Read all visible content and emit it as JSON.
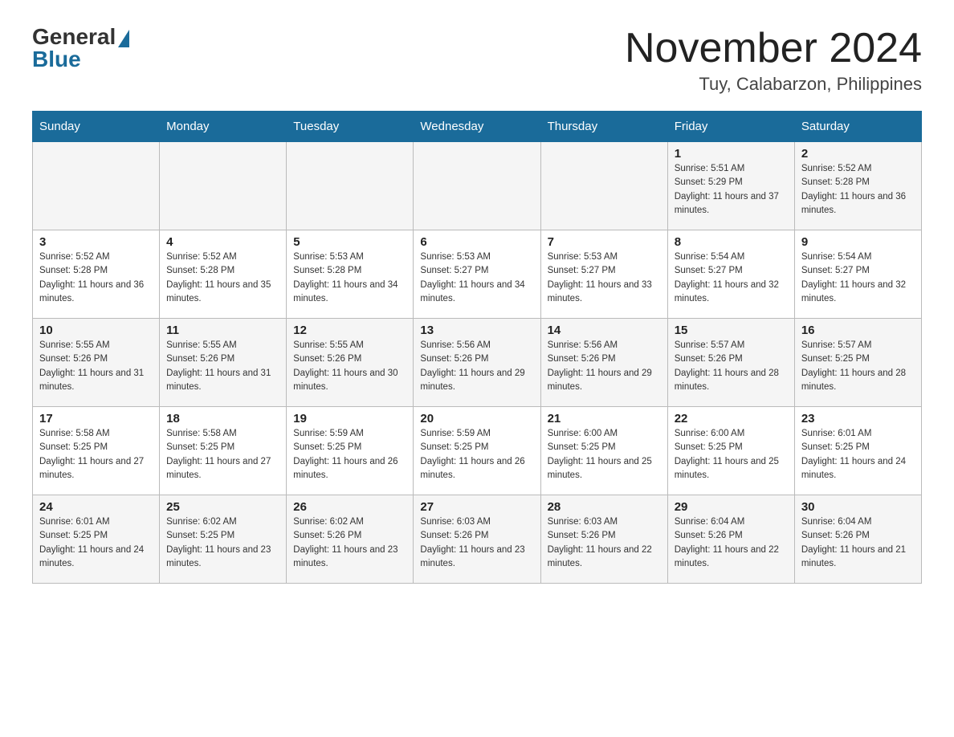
{
  "header": {
    "logo": {
      "general": "General",
      "blue": "Blue"
    },
    "title": "November 2024",
    "location": "Tuy, Calabarzon, Philippines"
  },
  "days_of_week": [
    "Sunday",
    "Monday",
    "Tuesday",
    "Wednesday",
    "Thursday",
    "Friday",
    "Saturday"
  ],
  "weeks": [
    [
      {
        "day": "",
        "sunrise": "",
        "sunset": "",
        "daylight": ""
      },
      {
        "day": "",
        "sunrise": "",
        "sunset": "",
        "daylight": ""
      },
      {
        "day": "",
        "sunrise": "",
        "sunset": "",
        "daylight": ""
      },
      {
        "day": "",
        "sunrise": "",
        "sunset": "",
        "daylight": ""
      },
      {
        "day": "",
        "sunrise": "",
        "sunset": "",
        "daylight": ""
      },
      {
        "day": "1",
        "sunrise": "Sunrise: 5:51 AM",
        "sunset": "Sunset: 5:29 PM",
        "daylight": "Daylight: 11 hours and 37 minutes."
      },
      {
        "day": "2",
        "sunrise": "Sunrise: 5:52 AM",
        "sunset": "Sunset: 5:28 PM",
        "daylight": "Daylight: 11 hours and 36 minutes."
      }
    ],
    [
      {
        "day": "3",
        "sunrise": "Sunrise: 5:52 AM",
        "sunset": "Sunset: 5:28 PM",
        "daylight": "Daylight: 11 hours and 36 minutes."
      },
      {
        "day": "4",
        "sunrise": "Sunrise: 5:52 AM",
        "sunset": "Sunset: 5:28 PM",
        "daylight": "Daylight: 11 hours and 35 minutes."
      },
      {
        "day": "5",
        "sunrise": "Sunrise: 5:53 AM",
        "sunset": "Sunset: 5:28 PM",
        "daylight": "Daylight: 11 hours and 34 minutes."
      },
      {
        "day": "6",
        "sunrise": "Sunrise: 5:53 AM",
        "sunset": "Sunset: 5:27 PM",
        "daylight": "Daylight: 11 hours and 34 minutes."
      },
      {
        "day": "7",
        "sunrise": "Sunrise: 5:53 AM",
        "sunset": "Sunset: 5:27 PM",
        "daylight": "Daylight: 11 hours and 33 minutes."
      },
      {
        "day": "8",
        "sunrise": "Sunrise: 5:54 AM",
        "sunset": "Sunset: 5:27 PM",
        "daylight": "Daylight: 11 hours and 32 minutes."
      },
      {
        "day": "9",
        "sunrise": "Sunrise: 5:54 AM",
        "sunset": "Sunset: 5:27 PM",
        "daylight": "Daylight: 11 hours and 32 minutes."
      }
    ],
    [
      {
        "day": "10",
        "sunrise": "Sunrise: 5:55 AM",
        "sunset": "Sunset: 5:26 PM",
        "daylight": "Daylight: 11 hours and 31 minutes."
      },
      {
        "day": "11",
        "sunrise": "Sunrise: 5:55 AM",
        "sunset": "Sunset: 5:26 PM",
        "daylight": "Daylight: 11 hours and 31 minutes."
      },
      {
        "day": "12",
        "sunrise": "Sunrise: 5:55 AM",
        "sunset": "Sunset: 5:26 PM",
        "daylight": "Daylight: 11 hours and 30 minutes."
      },
      {
        "day": "13",
        "sunrise": "Sunrise: 5:56 AM",
        "sunset": "Sunset: 5:26 PM",
        "daylight": "Daylight: 11 hours and 29 minutes."
      },
      {
        "day": "14",
        "sunrise": "Sunrise: 5:56 AM",
        "sunset": "Sunset: 5:26 PM",
        "daylight": "Daylight: 11 hours and 29 minutes."
      },
      {
        "day": "15",
        "sunrise": "Sunrise: 5:57 AM",
        "sunset": "Sunset: 5:26 PM",
        "daylight": "Daylight: 11 hours and 28 minutes."
      },
      {
        "day": "16",
        "sunrise": "Sunrise: 5:57 AM",
        "sunset": "Sunset: 5:25 PM",
        "daylight": "Daylight: 11 hours and 28 minutes."
      }
    ],
    [
      {
        "day": "17",
        "sunrise": "Sunrise: 5:58 AM",
        "sunset": "Sunset: 5:25 PM",
        "daylight": "Daylight: 11 hours and 27 minutes."
      },
      {
        "day": "18",
        "sunrise": "Sunrise: 5:58 AM",
        "sunset": "Sunset: 5:25 PM",
        "daylight": "Daylight: 11 hours and 27 minutes."
      },
      {
        "day": "19",
        "sunrise": "Sunrise: 5:59 AM",
        "sunset": "Sunset: 5:25 PM",
        "daylight": "Daylight: 11 hours and 26 minutes."
      },
      {
        "day": "20",
        "sunrise": "Sunrise: 5:59 AM",
        "sunset": "Sunset: 5:25 PM",
        "daylight": "Daylight: 11 hours and 26 minutes."
      },
      {
        "day": "21",
        "sunrise": "Sunrise: 6:00 AM",
        "sunset": "Sunset: 5:25 PM",
        "daylight": "Daylight: 11 hours and 25 minutes."
      },
      {
        "day": "22",
        "sunrise": "Sunrise: 6:00 AM",
        "sunset": "Sunset: 5:25 PM",
        "daylight": "Daylight: 11 hours and 25 minutes."
      },
      {
        "day": "23",
        "sunrise": "Sunrise: 6:01 AM",
        "sunset": "Sunset: 5:25 PM",
        "daylight": "Daylight: 11 hours and 24 minutes."
      }
    ],
    [
      {
        "day": "24",
        "sunrise": "Sunrise: 6:01 AM",
        "sunset": "Sunset: 5:25 PM",
        "daylight": "Daylight: 11 hours and 24 minutes."
      },
      {
        "day": "25",
        "sunrise": "Sunrise: 6:02 AM",
        "sunset": "Sunset: 5:25 PM",
        "daylight": "Daylight: 11 hours and 23 minutes."
      },
      {
        "day": "26",
        "sunrise": "Sunrise: 6:02 AM",
        "sunset": "Sunset: 5:26 PM",
        "daylight": "Daylight: 11 hours and 23 minutes."
      },
      {
        "day": "27",
        "sunrise": "Sunrise: 6:03 AM",
        "sunset": "Sunset: 5:26 PM",
        "daylight": "Daylight: 11 hours and 23 minutes."
      },
      {
        "day": "28",
        "sunrise": "Sunrise: 6:03 AM",
        "sunset": "Sunset: 5:26 PM",
        "daylight": "Daylight: 11 hours and 22 minutes."
      },
      {
        "day": "29",
        "sunrise": "Sunrise: 6:04 AM",
        "sunset": "Sunset: 5:26 PM",
        "daylight": "Daylight: 11 hours and 22 minutes."
      },
      {
        "day": "30",
        "sunrise": "Sunrise: 6:04 AM",
        "sunset": "Sunset: 5:26 PM",
        "daylight": "Daylight: 11 hours and 21 minutes."
      }
    ]
  ],
  "accent_color": "#1a6b9a"
}
